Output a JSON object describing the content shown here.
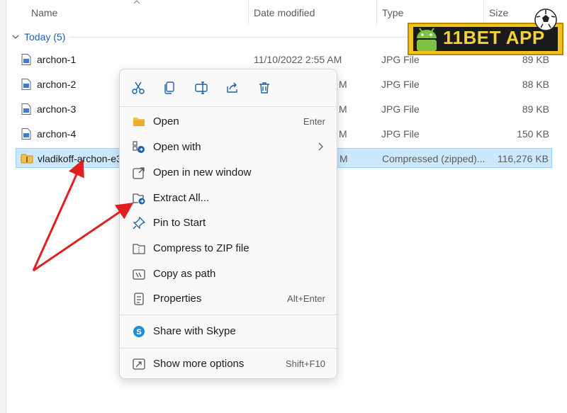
{
  "header": {
    "name": "Name",
    "date_modified": "Date modified",
    "type": "Type",
    "size": "Size"
  },
  "group": {
    "label": "Today (5)"
  },
  "files": [
    {
      "name": "archon-1",
      "date": "11/10/2022 2:55 AM",
      "type": "JPG File",
      "size": "89 KB"
    },
    {
      "name": "archon-2",
      "date": "",
      "type": "JPG File",
      "size": "88 KB"
    },
    {
      "name": "archon-3",
      "date": "",
      "type": "JPG File",
      "size": "89 KB"
    },
    {
      "name": "archon-4",
      "date": "",
      "type": "JPG File",
      "size": "150 KB"
    },
    {
      "name": "vladikoff-archon-e3",
      "date": "",
      "type": "Compressed (zipped)...",
      "size": "116,276 KB"
    }
  ],
  "date_fragments": [
    "M",
    "M",
    "M",
    "M"
  ],
  "logo": {
    "text": "11BET APP"
  },
  "menu": {
    "quick_actions": [
      "cut-icon",
      "copy-icon",
      "rename-icon",
      "share-icon",
      "delete-icon"
    ],
    "items": [
      {
        "label": "Open",
        "shortcut": "Enter",
        "icon": "folder-icon"
      },
      {
        "label": "Open with",
        "shortcut": "",
        "icon": "open-with-icon"
      },
      {
        "label": "Open in new window",
        "shortcut": "",
        "icon": "new-window-icon"
      },
      {
        "label": "Extract All...",
        "shortcut": "",
        "icon": "extract-icon"
      },
      {
        "label": "Pin to Start",
        "shortcut": "",
        "icon": "pin-icon"
      },
      {
        "label": "Compress to ZIP file",
        "shortcut": "",
        "icon": "zip-icon"
      },
      {
        "label": "Copy as path",
        "shortcut": "",
        "icon": "copy-path-icon"
      },
      {
        "label": "Properties",
        "shortcut": "Alt+Enter",
        "icon": "properties-icon"
      },
      {
        "label": "Share with Skype",
        "shortcut": "",
        "icon": "skype-icon"
      },
      {
        "label": "Show more options",
        "shortcut": "Shift+F10",
        "icon": "more-options-icon"
      }
    ]
  },
  "colors": {
    "selection_bg": "#cce8ff",
    "group_link": "#1c5fa8",
    "arrow": "#e02020",
    "logo_yellow": "#f4c21b"
  }
}
